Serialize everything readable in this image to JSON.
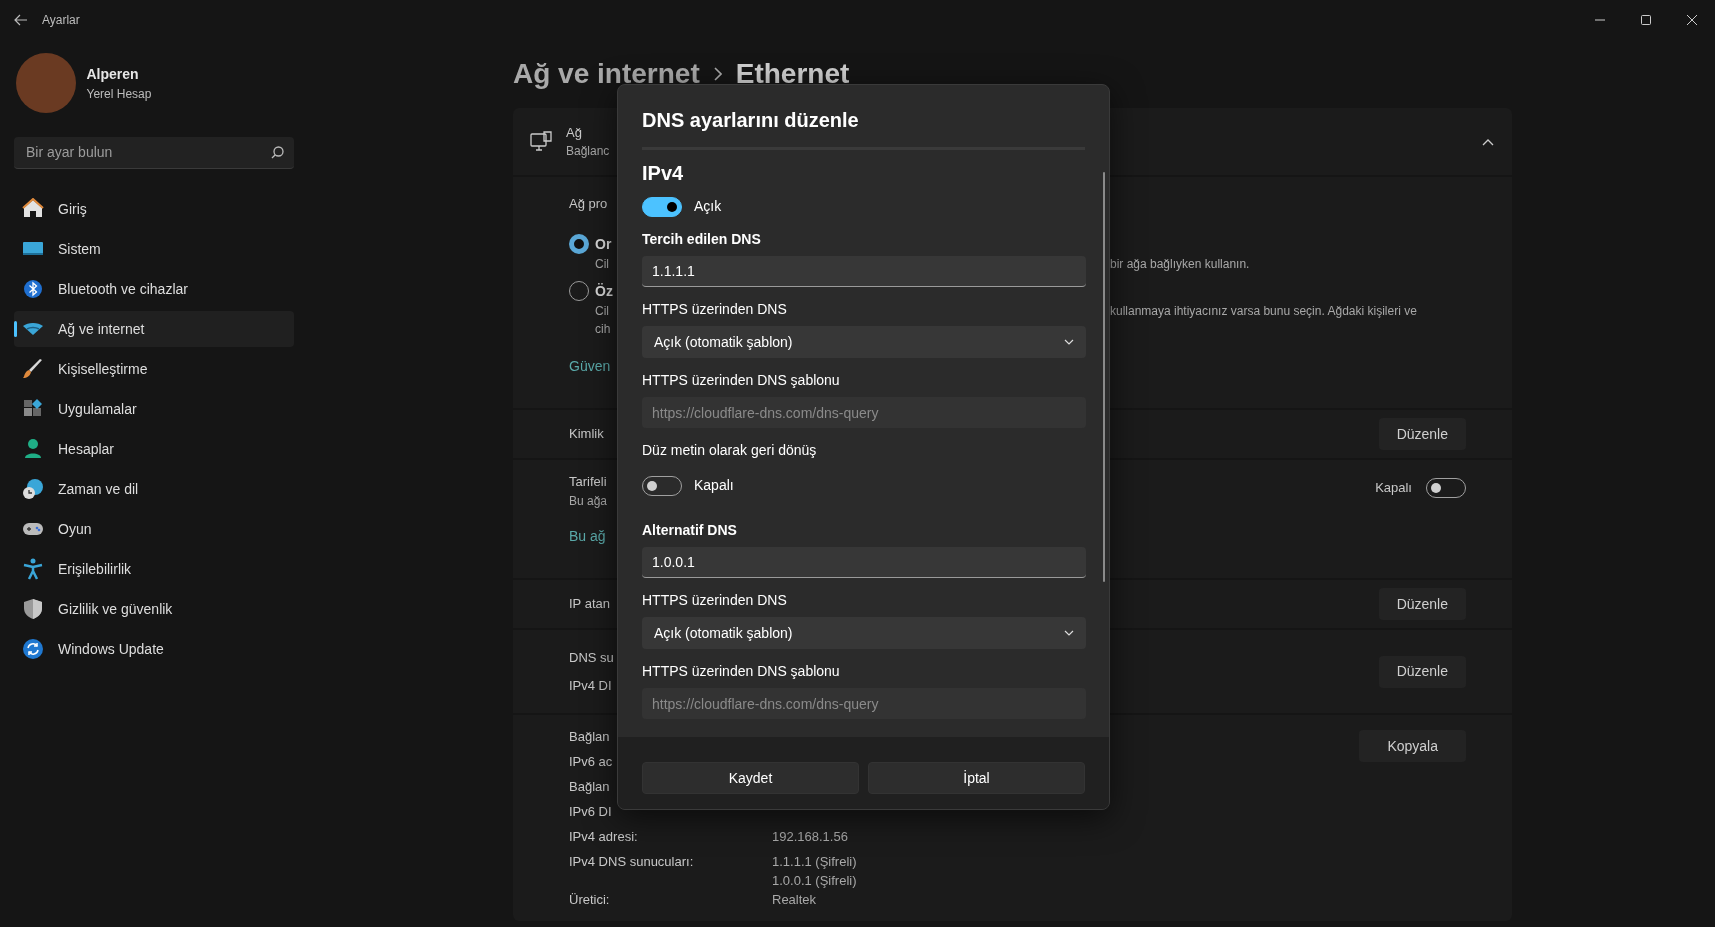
{
  "window": {
    "title": "Ayarlar"
  },
  "account": {
    "name": "Alperen",
    "type": "Yerel Hesap"
  },
  "search": {
    "placeholder": "Bir ayar bulun"
  },
  "nav": [
    {
      "label": "Giriş",
      "selected": false
    },
    {
      "label": "Sistem",
      "selected": false
    },
    {
      "label": "Bluetooth ve cihazlar",
      "selected": false
    },
    {
      "label": "Ağ ve internet",
      "selected": true
    },
    {
      "label": "Kişiselleştirme",
      "selected": false
    },
    {
      "label": "Uygulamalar",
      "selected": false
    },
    {
      "label": "Hesaplar",
      "selected": false
    },
    {
      "label": "Zaman ve dil",
      "selected": false
    },
    {
      "label": "Oyun",
      "selected": false
    },
    {
      "label": "Erişilebilirlik",
      "selected": false
    },
    {
      "label": "Gizlilik ve güvenlik",
      "selected": false
    },
    {
      "label": "Windows Update",
      "selected": false
    }
  ],
  "breadcrumb": {
    "parent": "Ağ ve internet",
    "current": "Ethernet"
  },
  "network_card": {
    "title": "Ağ",
    "subtitle": "Bağlanc",
    "expanded": true,
    "profile": {
      "label": "Ağ pro",
      "link": "Güven",
      "options": [
        {
          "title": "Or",
          "lines": [
            {
              "text": "Cil",
              "tail": "bir ağa bağlıyken kullanın."
            }
          ],
          "selected": true
        },
        {
          "title": "Öz",
          "lines": [
            {
              "text": "Cil",
              "tail": "kullanmaya ihtiyacınız varsa bunu seçin. Ağdaki kişileri ve"
            },
            {
              "text": "cih"
            }
          ],
          "selected": false
        }
      ]
    },
    "rows": [
      {
        "kind": "button",
        "lines": [
          "Kimlik"
        ],
        "button": "Düzenle"
      },
      {
        "kind": "toggle",
        "lines": [
          "Tarifeli"
        ],
        "sub": "Bu ağa",
        "state_label": "Kapalı",
        "on": false,
        "link": "Bu ağ"
      },
      {
        "kind": "button",
        "lines": [
          "IP atan"
        ],
        "button": "Düzenle"
      },
      {
        "kind": "button",
        "lines": [
          "DNS su",
          "IPv4 DI"
        ],
        "button": "Düzenle"
      },
      {
        "kind": "properties",
        "button": "Kopyala",
        "items": [
          {
            "label": "Bağlan"
          },
          {
            "label": "IPv6 ac"
          },
          {
            "label": "Bağlan"
          },
          {
            "label": "IPv6 DI"
          },
          {
            "label": "IPv4 adresi:",
            "values": [
              "192.168.1.56"
            ]
          },
          {
            "label": "IPv4 DNS sunucuları:",
            "values": [
              "1.1.1.1 (Şifreli)",
              "1.0.0.1 (Şifreli)"
            ]
          },
          {
            "label": "Üretici:",
            "values": [
              "Realtek"
            ]
          }
        ]
      }
    ]
  },
  "dialog": {
    "title": "DNS ayarlarını düzenle",
    "heading": "IPv4",
    "on": true,
    "state_label": "Açık",
    "servers": [
      {
        "label": "Tercih edilen DNS",
        "value": "1.1.1.1",
        "doh_label": "HTTPS üzerinden DNS",
        "doh_value": "Açık (otomatik şablon)",
        "template_label": "HTTPS üzerinden DNS şablonu",
        "template_placeholder": "https://cloudflare-dns.com/dns-query",
        "fallback": {
          "label": "Düz metin olarak geri dönüş",
          "on": false,
          "state_label": "Kapalı"
        }
      },
      {
        "label": "Alternatif DNS",
        "value": "1.0.0.1",
        "doh_label": "HTTPS üzerinden DNS",
        "doh_value": "Açık (otomatik şablon)",
        "template_label": "HTTPS üzerinden DNS şablonu",
        "template_placeholder": "https://cloudflare-dns.com/dns-query"
      }
    ],
    "buttons": [
      "Kaydet",
      "İptal"
    ]
  }
}
